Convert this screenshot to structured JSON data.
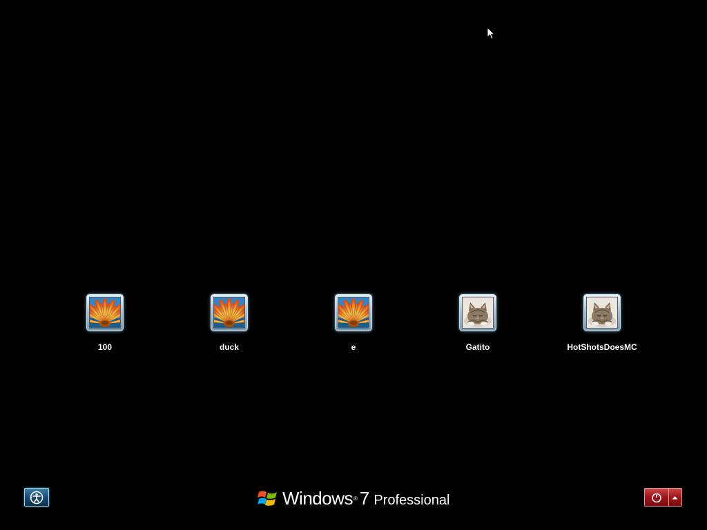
{
  "users": [
    {
      "name": "100",
      "picture": "flower-icon"
    },
    {
      "name": "duck",
      "picture": "flower-icon"
    },
    {
      "name": "e",
      "picture": "flower-icon"
    },
    {
      "name": "Gatito",
      "picture": "kitten-icon"
    },
    {
      "name": "HotShotsDoesMC",
      "picture": "kitten-icon"
    }
  ],
  "branding": {
    "product": "Windows",
    "trademark": "®",
    "version": "7",
    "edition": "Professional"
  },
  "controls": {
    "ease_of_access": "ease-of-access-icon",
    "shutdown": "power-icon",
    "shutdown_options": "arrow-up-icon"
  },
  "colors": {
    "background": "#000000",
    "shutdown_button": "#9e1518",
    "ease_button": "#1b4c74"
  }
}
